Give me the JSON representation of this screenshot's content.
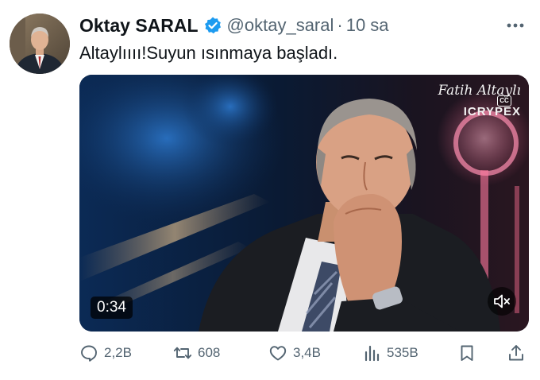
{
  "author": {
    "name": "Oktay SARAL",
    "handle": "@oktay_saral",
    "separator": "·",
    "time": "10 sa",
    "verified": true
  },
  "tweet": {
    "text": "Altaylıııı!Suyun ısınmaya başladı."
  },
  "video": {
    "watermark_name": "Fatih Altaylı",
    "watermark_brand": "ICRYPEX",
    "cc_label": "CC",
    "duration": "0:34",
    "muted": true
  },
  "actions": {
    "replies": "2,2B",
    "retweets": "608",
    "likes": "3,4B",
    "views": "535B"
  },
  "colors": {
    "text_primary": "#0f1419",
    "text_secondary": "#536471",
    "verified_blue": "#1d9bf0"
  },
  "icons": [
    "verified-badge-icon",
    "more-options-icon",
    "closed-caption-icon",
    "mute-icon",
    "reply-icon",
    "retweet-icon",
    "like-icon",
    "views-icon",
    "bookmark-icon",
    "share-icon"
  ]
}
